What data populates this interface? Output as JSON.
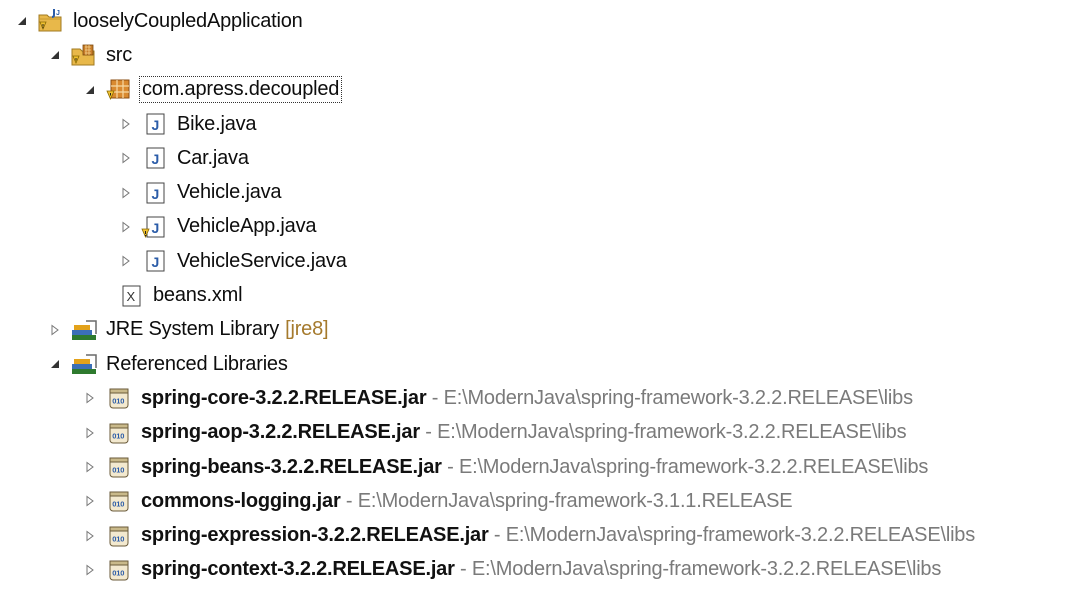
{
  "tree": {
    "project": {
      "label": "looselyCoupledApplication",
      "expanded": true,
      "icon": "java-project-icon"
    },
    "src": {
      "label": "src",
      "expanded": true,
      "icon": "source-folder-icon"
    },
    "package": {
      "label": "com.apress.decoupled",
      "expanded": true,
      "icon": "package-icon"
    },
    "java_files": [
      {
        "label": "Bike.java",
        "icon": "java-file-icon",
        "warning": false
      },
      {
        "label": "Car.java",
        "icon": "java-file-icon",
        "warning": false
      },
      {
        "label": "Vehicle.java",
        "icon": "java-file-icon",
        "warning": false
      },
      {
        "label": "VehicleApp.java",
        "icon": "java-file-warning-icon",
        "warning": true
      },
      {
        "label": "VehicleService.java",
        "icon": "java-file-icon",
        "warning": false
      }
    ],
    "xml_file": {
      "label": "beans.xml",
      "icon": "xml-file-icon"
    },
    "jre": {
      "label": "JRE System Library",
      "decoration": "[jre8]",
      "expanded": false,
      "icon": "library-icon"
    },
    "ref_libs": {
      "label": "Referenced Libraries",
      "expanded": true,
      "icon": "library-icon"
    },
    "jars": [
      {
        "name": "spring-core-3.2.2.RELEASE.jar",
        "separator": " - ",
        "path": "E:\\ModernJava\\spring-framework-3.2.2.RELEASE\\libs"
      },
      {
        "name": "spring-aop-3.2.2.RELEASE.jar",
        "separator": " - ",
        "path": "E:\\ModernJava\\spring-framework-3.2.2.RELEASE\\libs"
      },
      {
        "name": "spring-beans-3.2.2.RELEASE.jar",
        "separator": " - ",
        "path": "E:\\ModernJava\\spring-framework-3.2.2.RELEASE\\libs"
      },
      {
        "name": "commons-logging.jar",
        "separator": " - ",
        "path": "E:\\ModernJava\\spring-framework-3.1.1.RELEASE"
      },
      {
        "name": "spring-expression-3.2.2.RELEASE.jar",
        "separator": " - ",
        "path": "E:\\ModernJava\\spring-framework-3.2.2.RELEASE\\libs"
      },
      {
        "name": "spring-context-3.2.2.RELEASE.jar",
        "separator": " - ",
        "path": "E:\\ModernJava\\spring-framework-3.2.2.RELEASE\\libs"
      }
    ],
    "colors": {
      "path_text": "#7a7a7a",
      "decoration_text": "#a57a2d",
      "java_icon_blue": "#2b5ca8",
      "folder_yellow": "#e8b84a"
    }
  }
}
